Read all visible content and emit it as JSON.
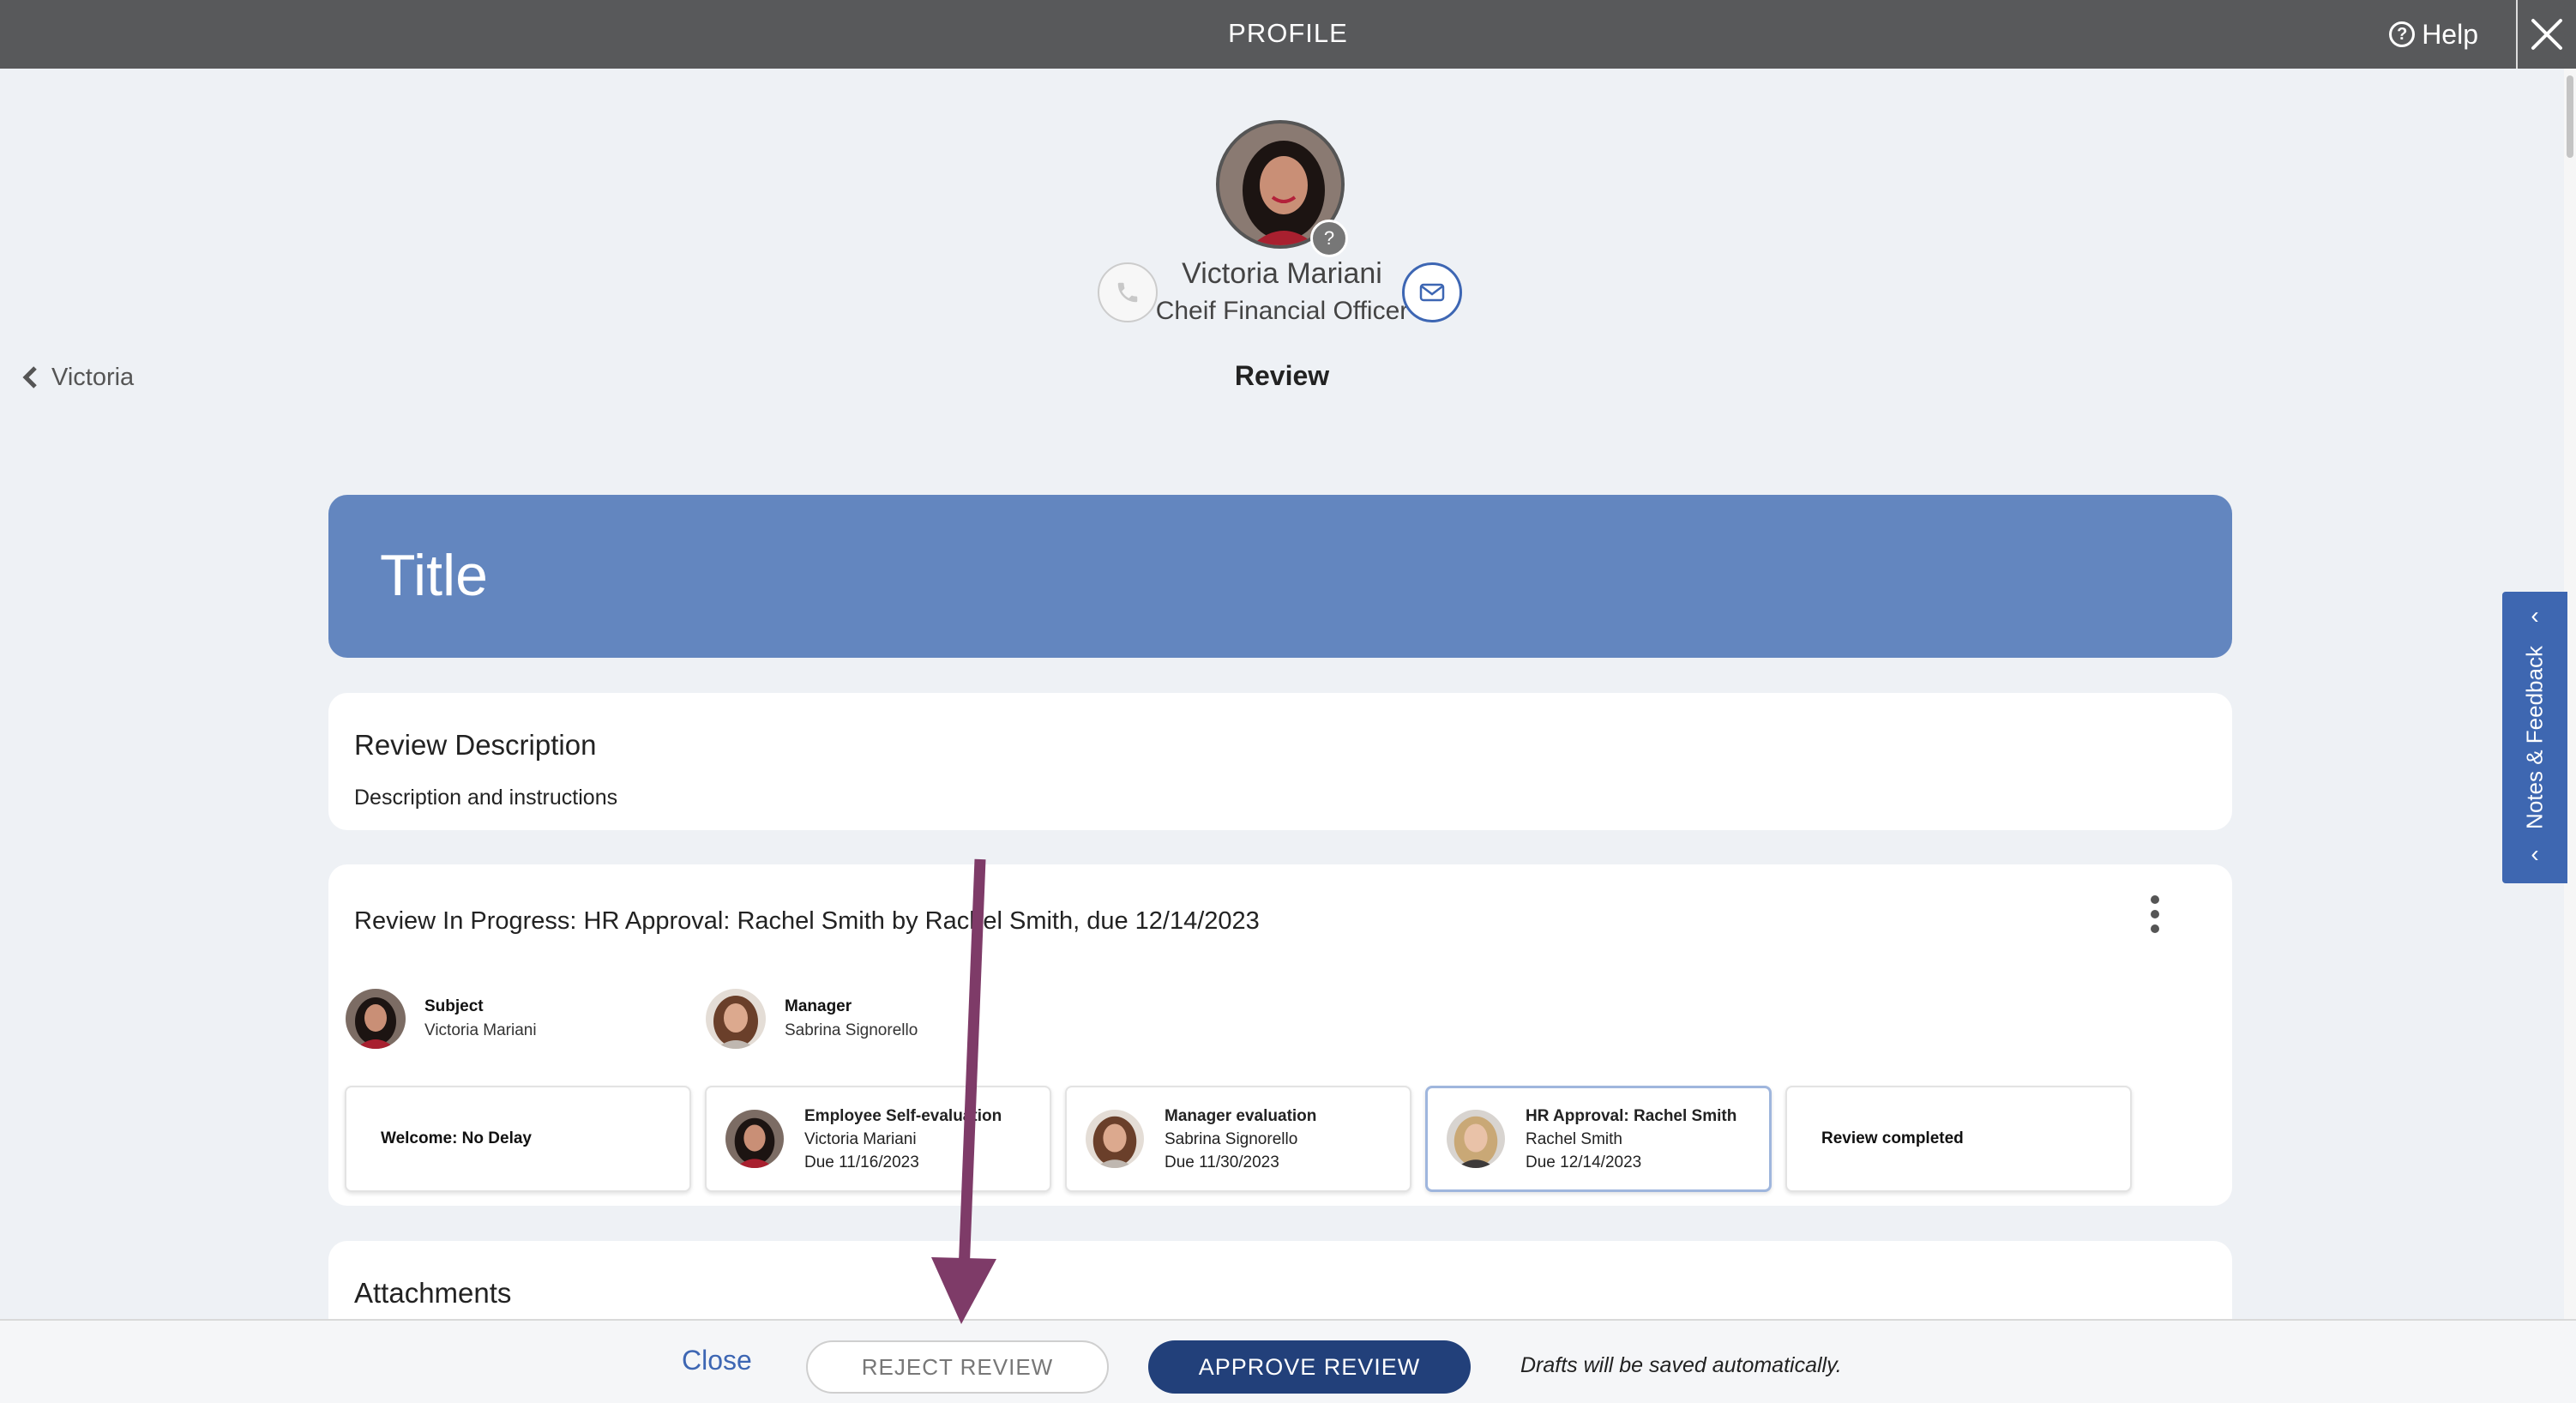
{
  "topbar": {
    "title": "PROFILE",
    "help_label": "Help"
  },
  "profile": {
    "name": "Victoria Mariani",
    "role": "Cheif Financial Officer",
    "status_badge": "?",
    "back_label": "Victoria",
    "section": "Review"
  },
  "review": {
    "title": "Title",
    "description_heading": "Review Description",
    "description_text": "Description and instructions",
    "status_line": "Review In Progress: HR Approval: Rachel Smith by Rachel Smith, due 12/14/2023",
    "subject": {
      "role": "Subject",
      "name": "Victoria Mariani"
    },
    "manager": {
      "role": "Manager",
      "name": "Sabrina Signorello"
    },
    "steps": [
      {
        "title": "Welcome: No Delay"
      },
      {
        "title": "Employee Self-evaluation",
        "person": "Victoria Mariani",
        "due": "Due 11/16/2023"
      },
      {
        "title": "Manager evaluation",
        "person": "Sabrina Signorello",
        "due": "Due 11/30/2023"
      },
      {
        "title": "HR Approval: Rachel Smith",
        "person": "Rachel Smith",
        "due": "Due 12/14/2023"
      },
      {
        "title": "Review completed"
      }
    ],
    "attachments_heading": "Attachments"
  },
  "side_tab": {
    "label": "Notes & Feedback"
  },
  "footer": {
    "close_label": "Close",
    "reject_label": "REJECT REVIEW",
    "approve_label": "APPROVE REVIEW",
    "drafts_note": "Drafts will be saved automatically."
  },
  "icons": [
    "help-icon",
    "close-icon",
    "phone-icon",
    "mail-icon",
    "chevron-left-icon",
    "kebab-menu-icon"
  ],
  "colors": {
    "topbar": "#58595b",
    "banner": "#6386bf",
    "accent": "#3e67b1",
    "approve": "#22407a",
    "annotation": "#7e3b68"
  }
}
